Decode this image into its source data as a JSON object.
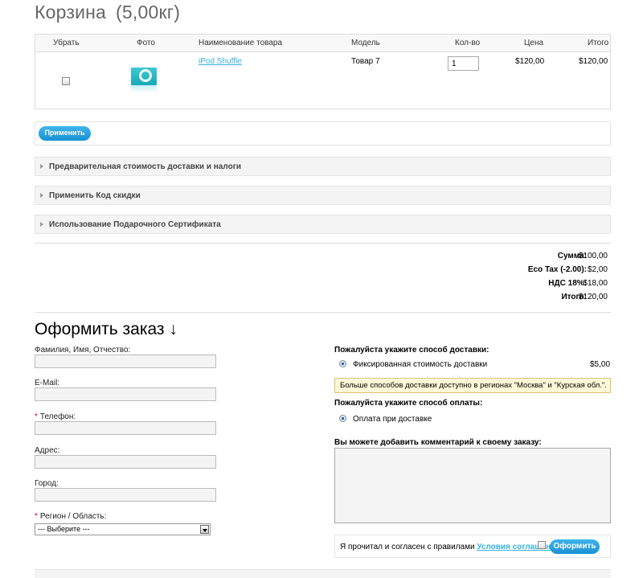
{
  "cart": {
    "title": "Корзина",
    "weight": "(5,00кг)",
    "headers": {
      "remove": "Убрать",
      "photo": "Фото",
      "name": "Наименование товара",
      "model": "Модель",
      "qty": "Кол-во",
      "price": "Цена",
      "total": "Итого"
    },
    "item": {
      "name": "iPod Shuffle",
      "model": "Товар 7",
      "qty": "1",
      "price": "$120,00",
      "total": "$120,00"
    },
    "apply_label": "Применить"
  },
  "accordions": [
    {
      "label": "Предварительная стоимость доставки и налоги"
    },
    {
      "label": "Применить Код скидки"
    },
    {
      "label": "Использование Подарочного Сертификата"
    }
  ],
  "totals": [
    {
      "label": "Сумма:",
      "value": "$100,00"
    },
    {
      "label": "Eco Tax (-2.00):",
      "value": "$2,00"
    },
    {
      "label": "НДС 18%:",
      "value": "$18,00"
    },
    {
      "label": "Итого:",
      "value": "$120,00"
    }
  ],
  "checkout": {
    "title": "Оформить заказ ↓",
    "fields": {
      "fullname": "Фамилия, Имя, Отчество:",
      "email": "E-Mail:",
      "phone": "Телефон:",
      "address": "Адрес:",
      "city": "Город:",
      "region": "Регион / Область:",
      "region_value": "--- Выберите ---",
      "required_mark": "*"
    },
    "shipping": {
      "heading": "Пожалуйста укажите способ доставки:",
      "option": "Фиксированная стоимость доставки",
      "price": "$5,00",
      "notice": "Больше способов доставки доступно в регионах \"Москва\" и \"Курская обл.\"."
    },
    "payment": {
      "heading": "Пожалуйста укажите способ оплаты:",
      "option": "Оплата при доставке"
    },
    "comment_label": "Вы можете добавить комментарий к своему заказу:",
    "agree_prefix": "Я прочитал и согласен с правилами",
    "agree_link": "Условия соглашения",
    "order_button": "Оформить"
  },
  "colors": {
    "accent": "#1891d3",
    "link": "#38b0e3",
    "required": "#ee0000"
  }
}
